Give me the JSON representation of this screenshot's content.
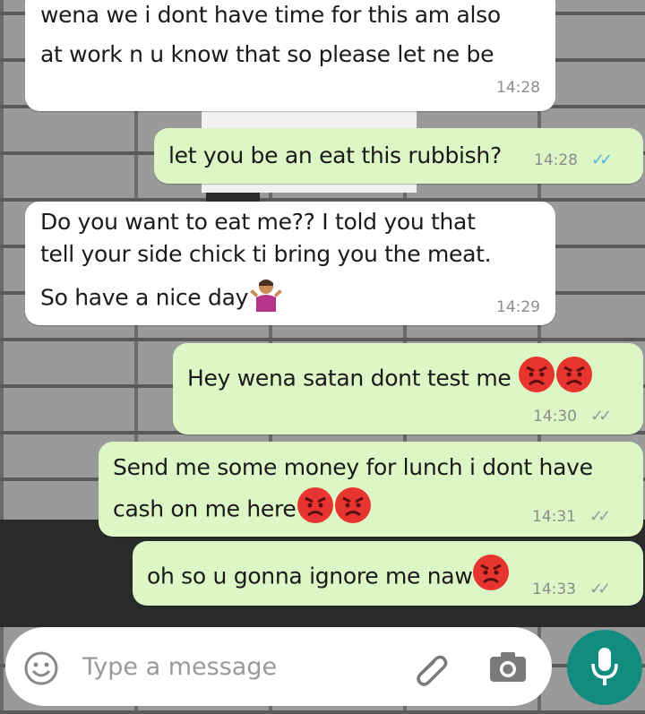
{
  "messages": [
    {
      "lines": [
        "wena we i dont have time for this am also",
        "at work n u know that so please let ne be"
      ],
      "time": "14:28"
    },
    {
      "text": "let you be an eat this rubbish?",
      "time": "14:28"
    },
    {
      "lines": [
        "Do you want to eat me?? I told you that",
        "tell your side chick ti bring you the  meat.",
        "So have a nice day"
      ],
      "time": "14:29"
    },
    {
      "text": "Hey wena satan dont test me",
      "time": "14:30"
    },
    {
      "lines": [
        "Send me some money for lunch i dont have",
        "cash on me here"
      ],
      "time": "14:31"
    },
    {
      "text": "oh so u gonna ignore me naw",
      "time": "14:33"
    }
  ],
  "composer": {
    "placeholder": "Type a message"
  },
  "icons": {
    "emoji": "smiley-icon",
    "attach": "paperclip-icon",
    "camera": "camera-icon",
    "mic": "microphone-icon",
    "angry": "angry-face-emoji",
    "shrug": "person-shrugging-emoji"
  },
  "colors": {
    "incoming": "#ffffff",
    "outgoing": "#dcf7c5",
    "read_ticks": "#4fb5ec",
    "mic_button": "#128c7e"
  }
}
